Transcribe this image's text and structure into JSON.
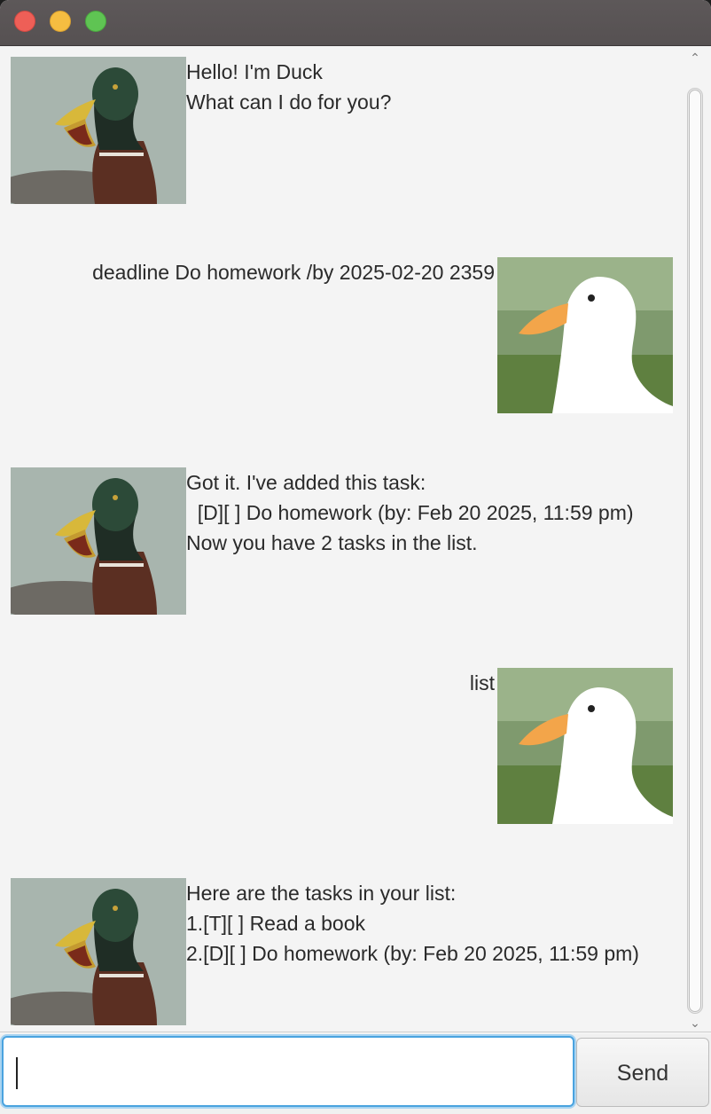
{
  "window": {
    "controls": [
      "close",
      "minimize",
      "zoom"
    ]
  },
  "dialogs": [
    {
      "speaker": "duck",
      "lines": [
        "Hello! I'm Duck",
        "What can I do for you?"
      ]
    },
    {
      "speaker": "user",
      "lines": [
        "deadline Do homework /by 2025-02-20 2359"
      ]
    },
    {
      "speaker": "duck",
      "lines": [
        "Got it. I've added this task:",
        "  [D][ ] Do homework (by: Feb 20 2025, 11:59 pm)",
        "Now you have 2 tasks in the list."
      ]
    },
    {
      "speaker": "user",
      "lines": [
        "list"
      ]
    },
    {
      "speaker": "duck",
      "lines": [
        "Here are the tasks in your list:",
        "1.[T][ ] Read a book",
        "2.[D][ ] Do homework (by: Feb 20 2025, 11:59 pm)"
      ]
    }
  ],
  "input": {
    "value": "",
    "placeholder": ""
  },
  "send_label": "Send",
  "colors": {
    "accent": "#4aa3df",
    "close": "#ee5f57",
    "minimize": "#f5bd41",
    "zoom": "#5fc453"
  }
}
